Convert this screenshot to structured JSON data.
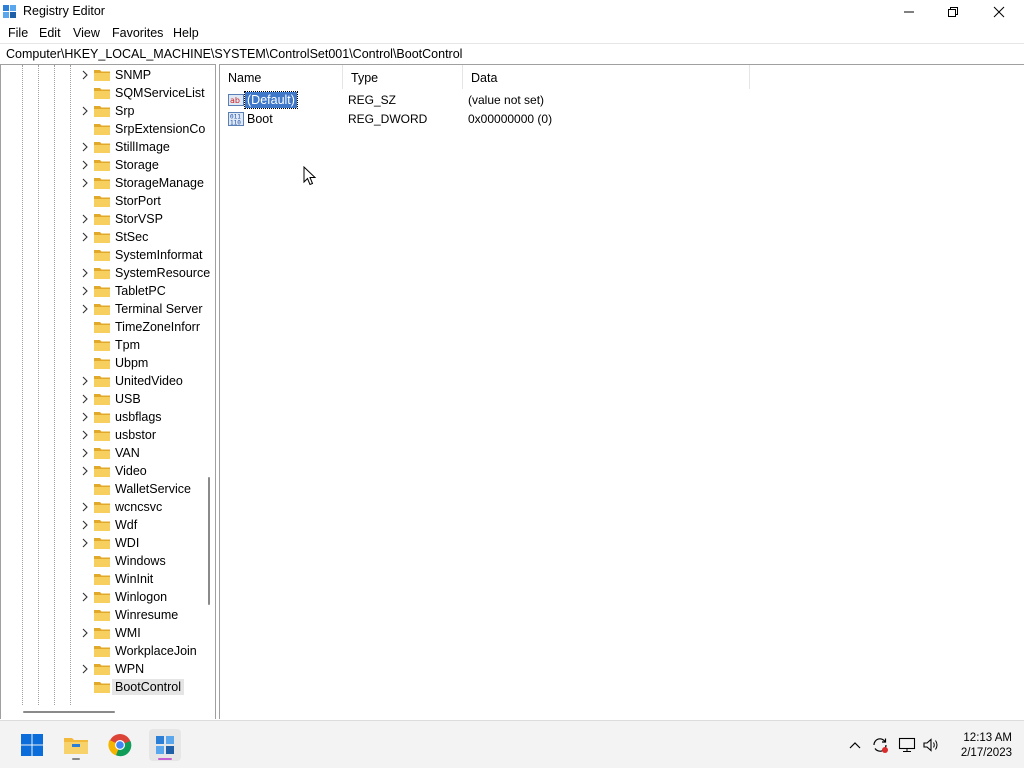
{
  "window": {
    "title": "Registry Editor"
  },
  "menu": [
    "File",
    "Edit",
    "View",
    "Favorites",
    "Help"
  ],
  "address": "Computer\\HKEY_LOCAL_MACHINE\\SYSTEM\\ControlSet001\\Control\\BootControl",
  "tree": {
    "items": [
      {
        "label": "SNMP",
        "expandable": true
      },
      {
        "label": "SQMServiceList",
        "expandable": false
      },
      {
        "label": "Srp",
        "expandable": true
      },
      {
        "label": "SrpExtensionCo",
        "expandable": false
      },
      {
        "label": "StillImage",
        "expandable": true
      },
      {
        "label": "Storage",
        "expandable": true
      },
      {
        "label": "StorageManage",
        "expandable": true
      },
      {
        "label": "StorPort",
        "expandable": false
      },
      {
        "label": "StorVSP",
        "expandable": true
      },
      {
        "label": "StSec",
        "expandable": true
      },
      {
        "label": "SystemInformat",
        "expandable": false
      },
      {
        "label": "SystemResource",
        "expandable": true
      },
      {
        "label": "TabletPC",
        "expandable": true
      },
      {
        "label": "Terminal Server",
        "expandable": true
      },
      {
        "label": "TimeZoneInforr",
        "expandable": false
      },
      {
        "label": "Tpm",
        "expandable": false
      },
      {
        "label": "Ubpm",
        "expandable": false
      },
      {
        "label": "UnitedVideo",
        "expandable": true
      },
      {
        "label": "USB",
        "expandable": true
      },
      {
        "label": "usbflags",
        "expandable": true
      },
      {
        "label": "usbstor",
        "expandable": true
      },
      {
        "label": "VAN",
        "expandable": true
      },
      {
        "label": "Video",
        "expandable": true
      },
      {
        "label": "WalletService",
        "expandable": false
      },
      {
        "label": "wcncsvc",
        "expandable": true
      },
      {
        "label": "Wdf",
        "expandable": true
      },
      {
        "label": "WDI",
        "expandable": true
      },
      {
        "label": "Windows",
        "expandable": false
      },
      {
        "label": "WinInit",
        "expandable": false
      },
      {
        "label": "Winlogon",
        "expandable": true
      },
      {
        "label": "Winresume",
        "expandable": false
      },
      {
        "label": "WMI",
        "expandable": true
      },
      {
        "label": "WorkplaceJoin",
        "expandable": false
      },
      {
        "label": "WPN",
        "expandable": true
      },
      {
        "label": "BootControl",
        "expandable": false,
        "selected": true
      }
    ]
  },
  "values": {
    "columns": {
      "name": "Name",
      "type": "Type",
      "data": "Data"
    },
    "rows": [
      {
        "name": "(Default)",
        "type": "REG_SZ",
        "data": "(value not set)",
        "icon": "string-value-icon",
        "selected": true
      },
      {
        "name": "Boot",
        "type": "REG_DWORD",
        "data": "0x00000000 (0)",
        "icon": "binary-value-icon",
        "selected": false
      }
    ]
  },
  "taskbar": {
    "time": "12:13 AM",
    "date": "2/17/2023"
  },
  "colors": {
    "selection": "#3f78c8",
    "folder": "#f0c24a",
    "accent": "#0a6dd9"
  }
}
